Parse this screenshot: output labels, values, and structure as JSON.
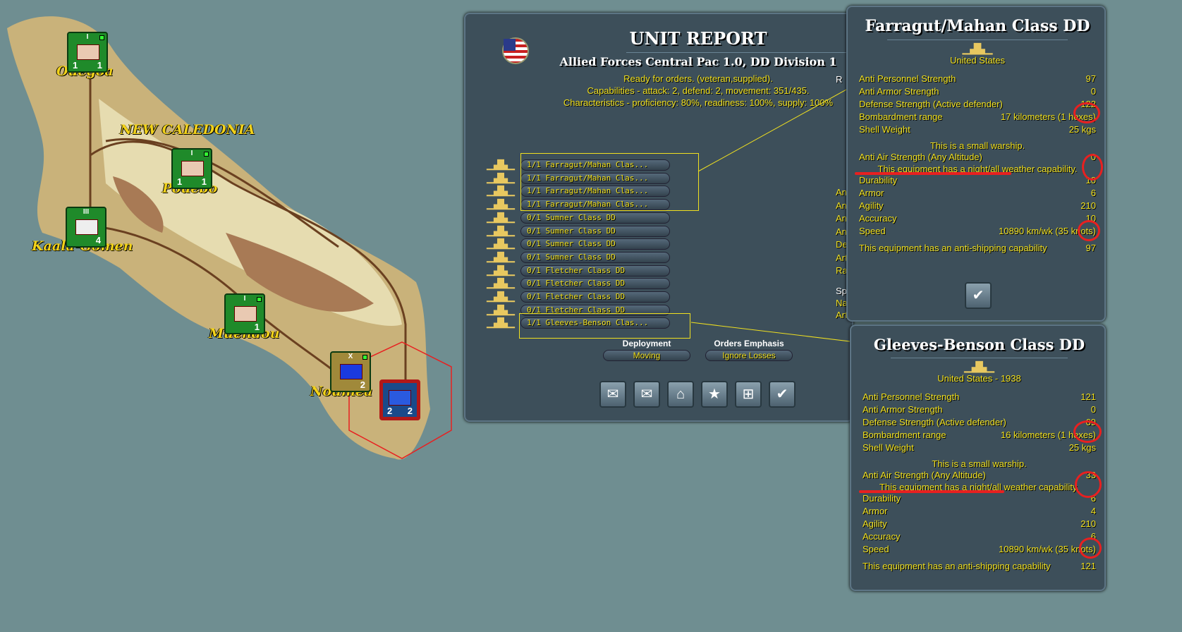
{
  "map": {
    "places": [
      "Ouegoa",
      "NEW CALEDONIA",
      "Pouebo",
      "Kaala-Gomen",
      "Muendou",
      "Noumea"
    ],
    "counters": [
      {
        "size": "I",
        "v": [
          "1",
          "1"
        ]
      },
      {
        "size": "I",
        "v": [
          "1",
          "1"
        ]
      },
      {
        "size": "III",
        "v": [
          "",
          "4"
        ]
      },
      {
        "size": "I",
        "v": [
          "",
          "1"
        ]
      },
      {
        "size": "X",
        "v": [
          "",
          "2"
        ]
      },
      {
        "size": "",
        "v": [
          "2",
          "2"
        ]
      }
    ]
  },
  "report": {
    "title": "UNIT REPORT",
    "subtitle": "Allied Forces Central Pac 1.0, DD Division 1",
    "status": "Ready for orders. (veteran,supplied).",
    "capabilities": "Capabilities - attack: 2, defend: 2, movement: 351/435.",
    "characteristics": "Characteristics - proficiency: 80%, readiness: 100%, supply: 100%",
    "cut_labels": [
      "R",
      "An",
      "An",
      "An",
      "An",
      "De",
      "Art",
      "Ran",
      "Sp",
      "Nav",
      "Artil"
    ],
    "equipment": [
      "1/1 Farragut/Mahan Clas...",
      "1/1 Farragut/Mahan Clas...",
      "1/1 Farragut/Mahan Clas...",
      "1/1 Farragut/Mahan Clas...",
      "0/1 Sumner Class DD",
      "0/1 Sumner Class DD",
      "0/1 Sumner Class DD",
      "0/1 Sumner Class DD",
      "0/1 Fletcher Class DD",
      "0/1 Fletcher Class DD",
      "0/1 Fletcher Class DD",
      "0/1 Fletcher Class DD",
      "1/1 Gleeves-Benson Clas..."
    ],
    "deployment_label": "Deployment",
    "deployment_value": "Moving",
    "orders_label": "Orders Emphasis",
    "orders_value": "Ignore Losses",
    "buttons": [
      "✉",
      "✉",
      "⌂",
      "★",
      "⊞",
      "✔"
    ]
  },
  "farragut": {
    "title": "Farragut/Mahan Class DD",
    "country": "United States",
    "rows1": [
      [
        "Anti Personnel Strength",
        "97"
      ],
      [
        "Anti Armor Strength",
        "0"
      ],
      [
        "Defense Strength  (Active defender)",
        "122"
      ],
      [
        "Bombardment range",
        "17 kilometers (1 hexes)"
      ],
      [
        "Shell Weight",
        "25 kgs"
      ]
    ],
    "note": "This is a small warship.",
    "aa": [
      "Anti Air Strength  (Any Altitude)",
      "0"
    ],
    "night": "This equipment has a night/all weather capability.",
    "rows2": [
      [
        "Durability",
        "10"
      ],
      [
        "Armor",
        "6"
      ],
      [
        "Agility",
        "210"
      ],
      [
        "Accuracy",
        "10"
      ],
      [
        "Speed",
        "10890 km/wk (35 knots)"
      ]
    ],
    "shipping": [
      "This equipment has an anti-shipping capability",
      "97"
    ],
    "ok": "✔"
  },
  "gleeves": {
    "title": "Gleeves-Benson Class DD",
    "country": "United States - 1938",
    "rows1": [
      [
        "Anti Personnel Strength",
        "121"
      ],
      [
        "Anti Armor Strength",
        "0"
      ],
      [
        "Defense Strength  (Active defender)",
        "69"
      ],
      [
        "Bombardment range",
        "16 kilometers (1 hexes)"
      ],
      [
        "Shell Weight",
        "25 kgs"
      ]
    ],
    "note": "This is a small warship.",
    "aa": [
      "Anti Air Strength  (Any Altitude)",
      "33"
    ],
    "night": "This equipment has a night/all weather capability.",
    "rows2": [
      [
        "Durability",
        "6"
      ],
      [
        "Armor",
        "4"
      ],
      [
        "Agility",
        "210"
      ],
      [
        "Accuracy",
        "6"
      ],
      [
        "Speed",
        "10890 km/wk (35 knots)"
      ]
    ],
    "shipping": [
      "This equipment has an anti-shipping capability",
      "121"
    ]
  },
  "colors": {
    "panel": "#3d4f5a",
    "text": "#f0e020",
    "sea": "#6f8e91",
    "highlight": "#e82020"
  }
}
